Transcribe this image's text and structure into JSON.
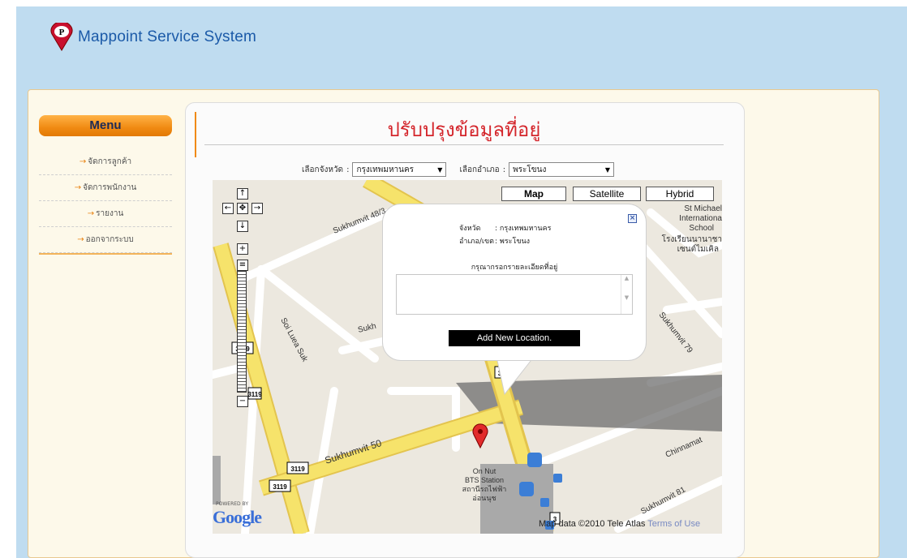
{
  "brand": {
    "name": "Mappoint  Service  System",
    "mark": "P"
  },
  "menu": {
    "header": "Menu",
    "items": [
      {
        "label": "จัดการลูกค้า"
      },
      {
        "label": "จัดการพนักงาน"
      },
      {
        "label": "รายงาน"
      },
      {
        "label": "ออกจากระบบ"
      }
    ]
  },
  "page": {
    "title": "ปรับปรุงข้อมูลที่อยู่"
  },
  "selectors": {
    "province_label": "เลือกจังหวัด",
    "province_value": "กรุงเทพมหานคร",
    "district_label": "เลือกอำเภอ",
    "district_value": "พระโขนง"
  },
  "map": {
    "types": [
      "Map",
      "Satellite",
      "Hybrid"
    ],
    "selected_type": "Map",
    "labels": {
      "sukhumvit_483": "Sukhumvit 48/3",
      "sukhumvit_50": "Sukhumvit 50",
      "soi_luea_suk": "Soi Luea Suk",
      "sukhumvit_79": "Sukhumvit 79",
      "sukhumvit_81": "Sukhumvit 81",
      "chinnamat": "Chinnamat",
      "sukh": "Sukh",
      "st_michael_1": "St Michael",
      "st_michael_2": "Internationa",
      "st_michael_3": "School",
      "st_michael_th1": "โรงเรียนนานาชา",
      "st_michael_th2": "เซนต์ไมเคิล",
      "on_nut_1": "On Nut",
      "on_nut_2": "BTS Station",
      "on_nut_th1": "สถานีรถไฟฟ้า",
      "on_nut_th2": "อ่อนนุช",
      "route_3119": "3119",
      "route_3": "3"
    },
    "powered_by": "POWERED BY",
    "google": "Google",
    "copyright": "Map data ©2010 Tele Atlas",
    "terms": "Terms of Use"
  },
  "popup": {
    "province_label": "จังหวัด",
    "province_value": ": กรุงเทพมหานคร",
    "district_label": "อำเภอ/เขต",
    "district_value": ": พระโขนง",
    "prompt": "กรุณากรอกรายละเอียดที่อยู่",
    "textarea_value": "",
    "button": "Add New Location."
  },
  "colors": {
    "accent": "#f08a12",
    "title": "#d4262c",
    "road_yellow": "#f6e36b",
    "brand": "#1b5aa8"
  }
}
